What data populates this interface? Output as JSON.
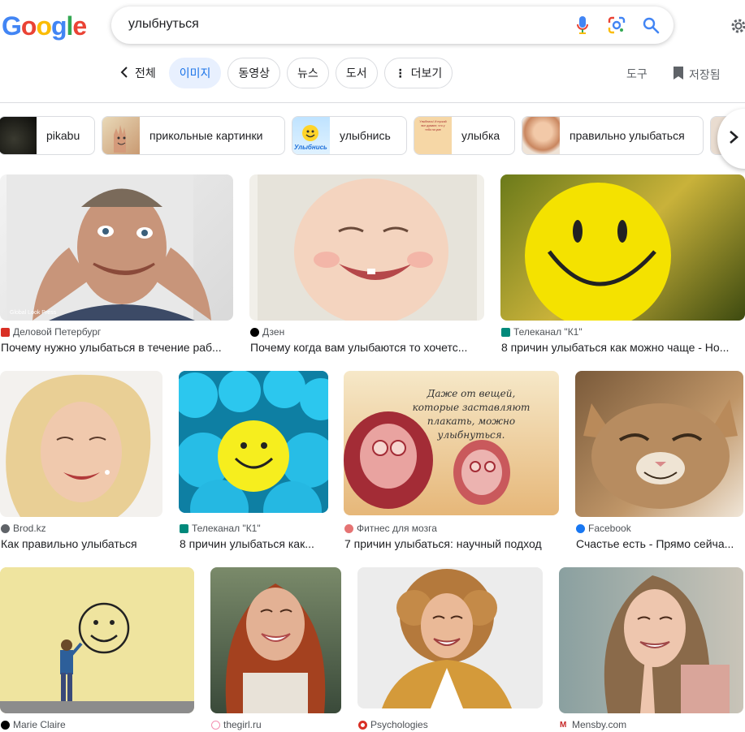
{
  "logo": {
    "letters": [
      "G",
      "o",
      "o",
      "g",
      "l",
      "e"
    ],
    "colors": [
      "#4285f4",
      "#ea4335",
      "#fbbc05",
      "#4285f4",
      "#34a853",
      "#ea4335"
    ]
  },
  "search": {
    "query": "улыбнуться"
  },
  "tabs": {
    "back_label": "전체",
    "items": [
      "이미지",
      "동영상",
      "뉴스",
      "도서",
      "더보기"
    ],
    "tools": "도구",
    "saved": "저장됨"
  },
  "related": [
    "pikabu",
    "прикольные картинки",
    "улыбнись",
    "улыбка",
    "правильно улыбаться"
  ],
  "related_thumb_text": {
    "smile": "Улыбнись",
    "note": "Улыбнись! И пускай все думают, что у тебя на уме"
  },
  "results": [
    {
      "source": "Деловой Петербург",
      "title": "Почему нужно улыбаться в течение раб...",
      "fav_color": "#d93025",
      "watermark": "Global Look Press"
    },
    {
      "source": "Дзен",
      "title": "Почему когда вам улыбаются то хочетс...",
      "fav_color": "#000000"
    },
    {
      "source": "Телеканал \"К1\"",
      "title": "8 причин улыбаться как можно чаще - Но...",
      "fav_color": "#00897b"
    },
    {
      "source": "Brod.kz",
      "title": "Как правильно улыбаться",
      "fav_color": "#5f6368"
    },
    {
      "source": "Телеканал \"К1\"",
      "title": "8 причин улыбаться как...",
      "fav_color": "#00897b"
    },
    {
      "source": "Фитнес для мозга",
      "title": "7 причин улыбаться: научный подход",
      "fav_color": "#e57373",
      "image_text": "Даже от вещей, которые заставляют плакать, можно улыбнуться."
    },
    {
      "source": "Facebook",
      "title": "Счастье есть - Прямо сейча...",
      "fav_color": "#1877f2"
    },
    {
      "source": "Marie Claire",
      "title": "",
      "fav_color": "#000000"
    },
    {
      "source": "thegirl.ru",
      "title": "",
      "fav_color": "#f48fb1"
    },
    {
      "source": "Psychologies",
      "title": "",
      "fav_color": "#d93025"
    },
    {
      "source": "Mensby.com",
      "title": "",
      "fav_color": "#c62828"
    }
  ],
  "colors": {
    "accent": "#1a73e8",
    "active_chip_bg": "#e8f0fe",
    "border": "#dadce0"
  }
}
